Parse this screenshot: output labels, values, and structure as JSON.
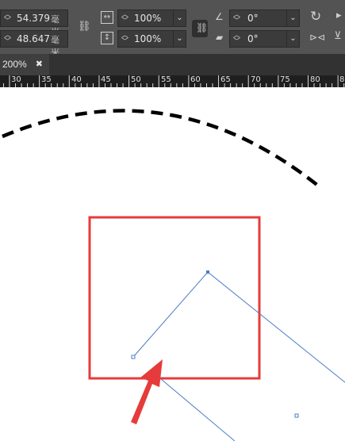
{
  "toolbar": {
    "x_value": "54.379",
    "x_unit": "毫米",
    "y_value": "48.647",
    "y_unit": "毫米",
    "scale_x": "100%",
    "scale_y": "100%",
    "rotate_angle": "0°",
    "shear_angle": "0°"
  },
  "tab": {
    "label": "200%",
    "close": "✖"
  },
  "ruler": {
    "labels": [
      "30",
      "35",
      "40",
      "45",
      "50",
      "55",
      "60",
      "65",
      "70",
      "75",
      "80",
      "8"
    ]
  },
  "colors": {
    "toolbar_bg": "#535353",
    "tab_bar_bg": "#323232",
    "ruler_bg": "#1f1f1f",
    "highlight_box": "#e63b3b",
    "path_stroke": "#4a7cc4",
    "arrow": "#e63b3b"
  },
  "icons": [
    "chain-unlinked-icon",
    "width-scale-icon",
    "height-scale-icon",
    "link-icon",
    "rotate-icon",
    "shear-icon",
    "rotate-clockwise-icon",
    "flip-horizontal-icon",
    "flip-vertical-icon"
  ]
}
